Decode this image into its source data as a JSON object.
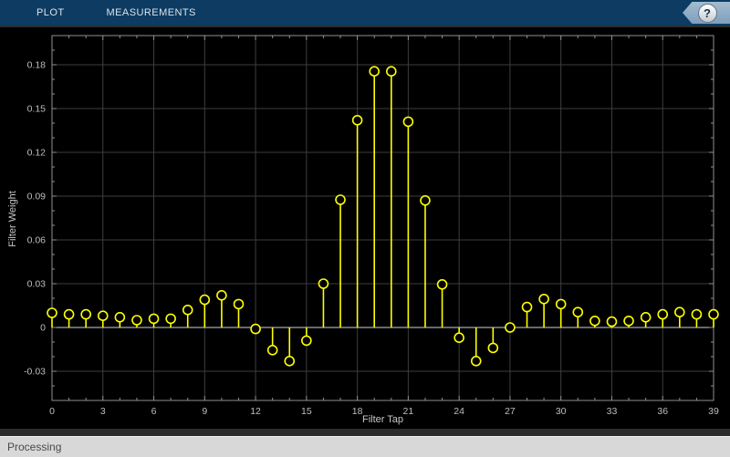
{
  "toolbar": {
    "tabs": [
      {
        "label": "PLOT"
      },
      {
        "label": "MEASUREMENTS"
      }
    ],
    "help_label": "?",
    "colors": {
      "bg": "#0d3b61",
      "text": "#d9e3ec",
      "banner": "#8dabc5"
    }
  },
  "status_bar": {
    "text": "Processing",
    "bg": "#d8d8d8"
  },
  "chart_data": {
    "type": "stem",
    "title": "",
    "xlabel": "Filter Tap",
    "ylabel": "Filter Weight",
    "x": [
      0,
      1,
      2,
      3,
      4,
      5,
      6,
      7,
      8,
      9,
      10,
      11,
      12,
      13,
      14,
      15,
      16,
      17,
      18,
      19,
      20,
      21,
      22,
      23,
      24,
      25,
      26,
      27,
      28,
      29,
      30,
      31,
      32,
      33,
      34,
      35,
      36,
      37,
      38,
      39
    ],
    "values": [
      0.01,
      0.009,
      0.009,
      0.008,
      0.007,
      0.005,
      0.006,
      0.006,
      0.012,
      0.019,
      0.022,
      0.016,
      -0.001,
      -0.0155,
      -0.023,
      -0.009,
      0.03,
      0.0875,
      0.142,
      0.1755,
      0.1755,
      0.141,
      0.087,
      0.0295,
      -0.007,
      -0.023,
      -0.014,
      0.0,
      0.014,
      0.0195,
      0.016,
      0.0105,
      0.0045,
      0.004,
      0.0045,
      0.007,
      0.009,
      0.0105,
      0.009,
      0.009
    ],
    "xlim": [
      0,
      39
    ],
    "ylim": [
      -0.05,
      0.2
    ],
    "x_major_ticks": [
      0,
      3,
      6,
      9,
      12,
      15,
      18,
      21,
      24,
      27,
      30,
      33,
      36,
      39
    ],
    "x_minor_step": 1,
    "y_major_ticks": [
      {
        "v": -0.03,
        "label": "-0.03"
      },
      {
        "v": 0,
        "label": "0"
      },
      {
        "v": 0.03,
        "label": "0.03"
      },
      {
        "v": 0.06,
        "label": "0.06"
      },
      {
        "v": 0.09,
        "label": "0.09"
      },
      {
        "v": 0.12,
        "label": "0.12"
      },
      {
        "v": 0.15,
        "label": "0.15"
      },
      {
        "v": 0.18,
        "label": "0.18"
      }
    ],
    "y_minor_step": 0.01,
    "grid": true,
    "legend": null,
    "colors": {
      "stem": "#ffff00",
      "grid": "#3e3e3e",
      "baseline": "#d0d0d0",
      "axis_border": "#909090",
      "tick": "#909090",
      "tick_label": "#bdbdbd",
      "axis_label": "#c8c8c8",
      "plot_bg": "#000000"
    }
  }
}
